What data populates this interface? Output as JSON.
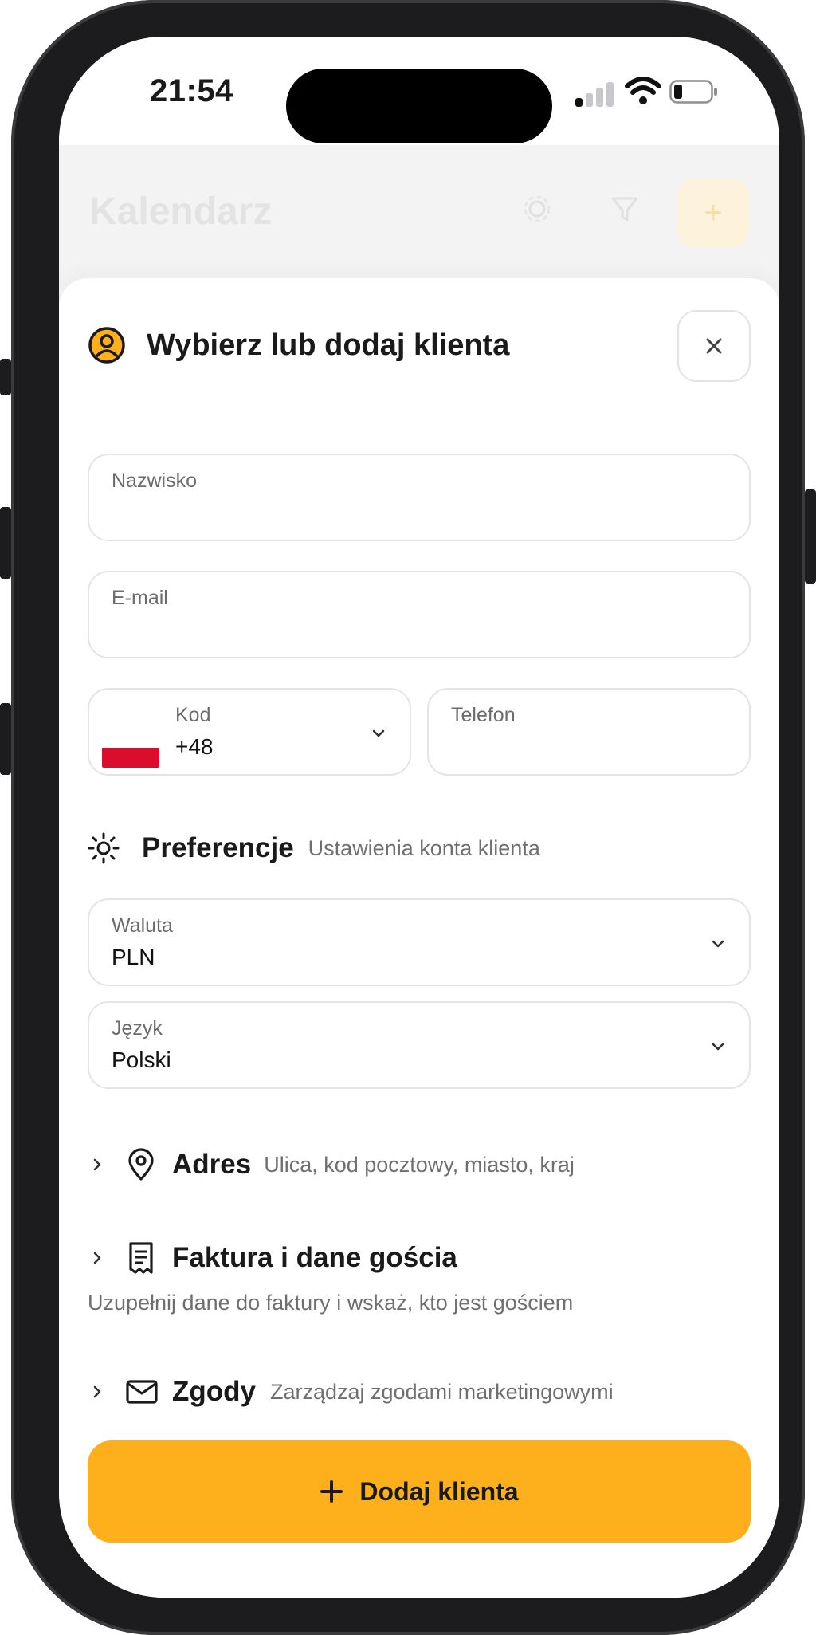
{
  "status_bar": {
    "time": "21:54"
  },
  "background_page": {
    "title": "Kalendarz"
  },
  "sheet": {
    "title": "Wybierz lub dodaj klienta",
    "close_label": "×",
    "fields": {
      "surname": {
        "label": "Nazwisko",
        "value": ""
      },
      "email": {
        "label": "E-mail",
        "value": ""
      },
      "code": {
        "label": "Kod",
        "value": "+48"
      },
      "phone": {
        "label": "Telefon",
        "value": ""
      }
    },
    "preferences": {
      "title": "Preferencje",
      "subtitle": "Ustawienia konta klienta",
      "currency": {
        "label": "Waluta",
        "value": "PLN"
      },
      "language": {
        "label": "Język",
        "value": "Polski"
      }
    },
    "address": {
      "title": "Adres",
      "subtitle": "Ulica, kod pocztowy, miasto, kraj"
    },
    "invoice": {
      "title": "Faktura i dane gościa",
      "description": "Uzupełnij dane do faktury i wskaż, kto jest gościem"
    },
    "consents": {
      "title": "Zgody",
      "subtitle": "Zarządzaj zgodami marketingowymi"
    },
    "submit": {
      "label": "Dodaj klienta"
    }
  },
  "colors": {
    "accent": "#fdb01b",
    "flag_red": "#dc0c2c",
    "text_primary": "#1a1a1a",
    "text_secondary": "#6f6f6f",
    "border": "#e4e4e4"
  },
  "icons": {
    "header": "user-circle-icon",
    "close": "close-icon",
    "preferences": "sun-icon",
    "address": "map-pin-icon",
    "invoice": "receipt-icon",
    "consents": "mail-icon",
    "expand": "chevron-right-icon",
    "dropdown": "chevron-down-icon",
    "submit": "plus-icon"
  }
}
